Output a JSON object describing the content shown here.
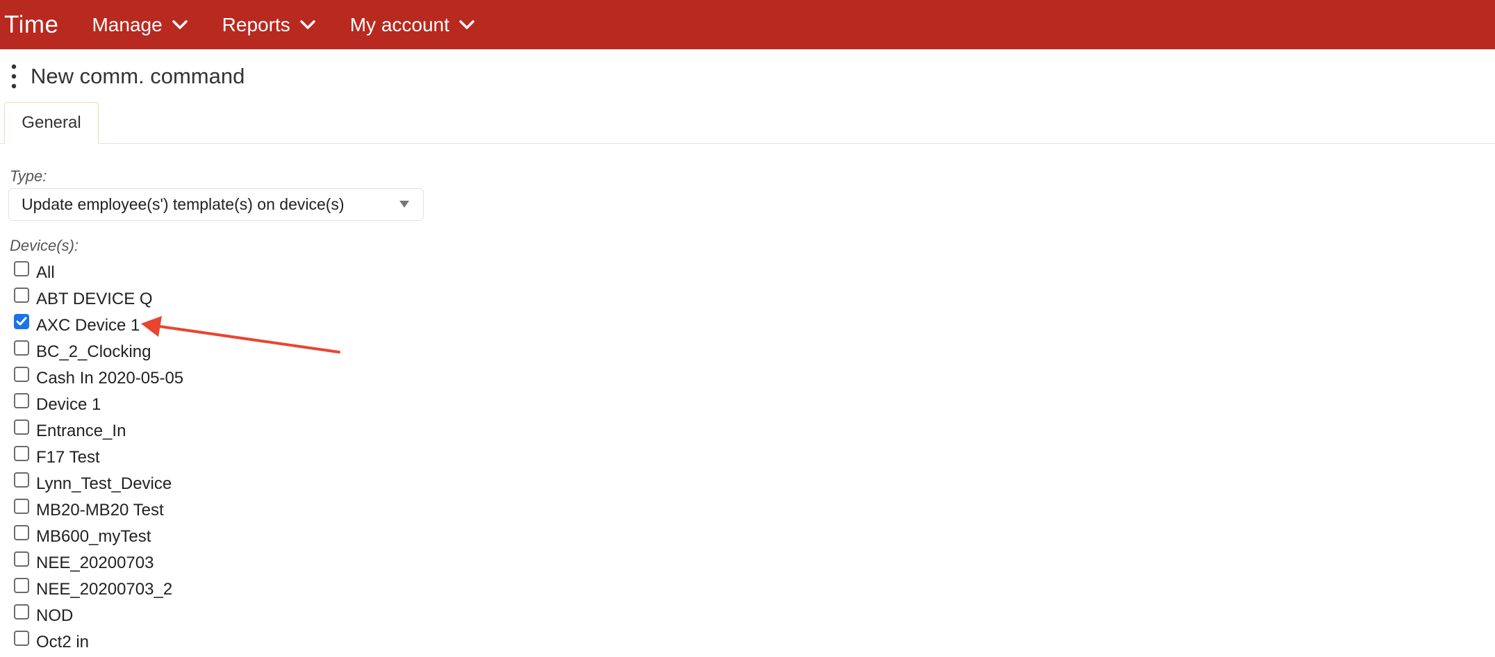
{
  "app": {
    "title": "Time"
  },
  "nav": {
    "items": [
      {
        "label": "Manage"
      },
      {
        "label": "Reports"
      },
      {
        "label": "My account"
      }
    ]
  },
  "page": {
    "title": "New comm. command"
  },
  "tabs": [
    {
      "label": "General",
      "active": true
    }
  ],
  "form": {
    "type_label": "Type:",
    "type_value": "Update employee(s') template(s) on device(s)",
    "devices_label": "Device(s):",
    "devices": [
      {
        "label": "All",
        "checked": false
      },
      {
        "label": "ABT DEVICE Q",
        "checked": false
      },
      {
        "label": "AXC Device 1",
        "checked": true
      },
      {
        "label": "BC_2_Clocking",
        "checked": false
      },
      {
        "label": "Cash In 2020-05-05",
        "checked": false
      },
      {
        "label": "Device 1",
        "checked": false
      },
      {
        "label": "Entrance_In",
        "checked": false
      },
      {
        "label": "F17 Test",
        "checked": false
      },
      {
        "label": "Lynn_Test_Device",
        "checked": false
      },
      {
        "label": "MB20-MB20 Test",
        "checked": false
      },
      {
        "label": "MB600_myTest",
        "checked": false
      },
      {
        "label": "NEE_20200703",
        "checked": false
      },
      {
        "label": "NEE_20200703_2",
        "checked": false
      },
      {
        "label": "NOD",
        "checked": false
      },
      {
        "label": "Oct2 in",
        "checked": false
      }
    ]
  },
  "icons": {
    "menu_more": "vertical-dots-icon",
    "nav_chevron": "chevron-down-icon",
    "select_caret": "caret-down-icon",
    "checkbox_check": "check-icon",
    "annotation": "red-arrow"
  },
  "colors": {
    "topbar": "#b8291f",
    "checkbox_checked": "#1a73e8",
    "tab_border": "#f0d9b3",
    "annotation_arrow": "#e8452f"
  }
}
